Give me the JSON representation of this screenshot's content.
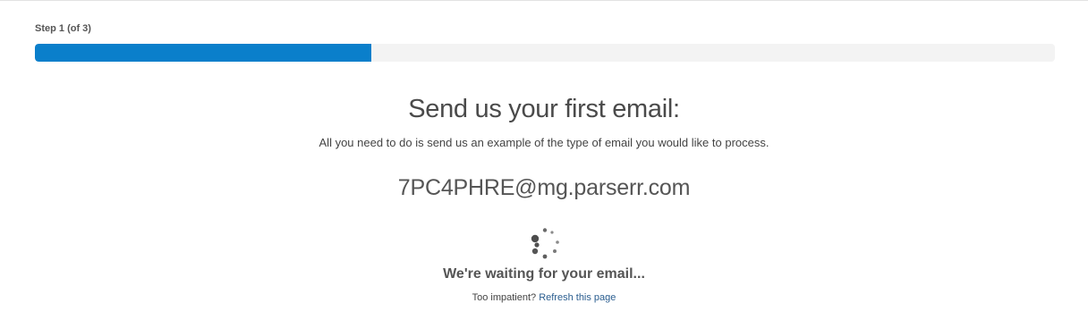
{
  "progress": {
    "step_label": "Step 1 (of 3)",
    "fraction": 0.33,
    "fill_color": "#0a7fcb",
    "track_color": "#f3f3f3"
  },
  "main": {
    "heading": "Send us your first email:",
    "subtext": "All you need to do is send us an example of the type of email you would like to process.",
    "email_address": "7PC4PHRE@mg.parserr.com",
    "spinner_icon": "loading-spinner-icon",
    "waiting_text": "We're waiting for your email...",
    "impatient_text": "Too impatient?",
    "refresh_link": "Refresh this page"
  }
}
